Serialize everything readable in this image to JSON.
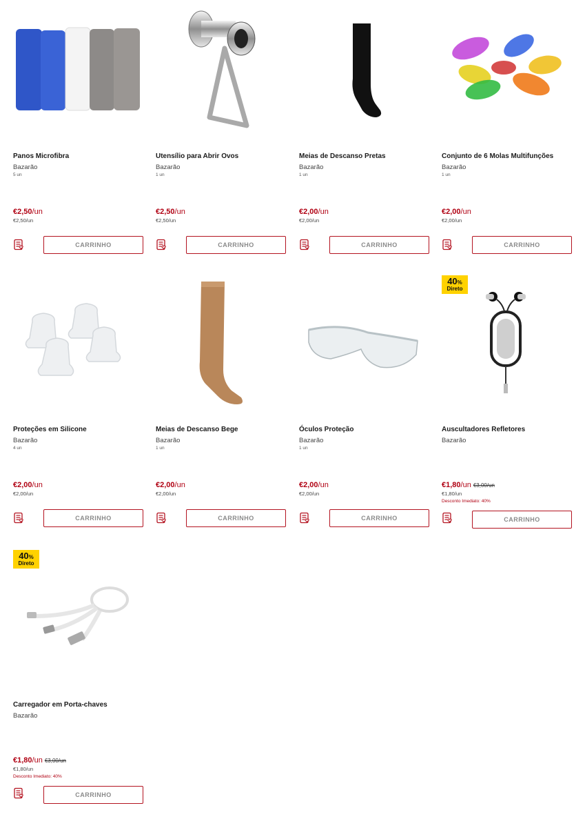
{
  "cart_label": "CARRINHO",
  "badge": {
    "pct": "40",
    "pct_sign": "%",
    "label": "Direto"
  },
  "products": [
    {
      "name": "Panos Microfibra",
      "brand": "Bazarão",
      "qty": "5 un",
      "price": "€2,50",
      "unit": "/un",
      "ppu": "€2,50/un",
      "old": "",
      "discount": "",
      "image_icon": "microfiber-towels"
    },
    {
      "name": "Utensílio para Abrir Ovos",
      "brand": "Bazarão",
      "qty": "1 un",
      "price": "€2,50",
      "unit": "/un",
      "ppu": "€2,50/un",
      "old": "",
      "discount": "",
      "image_icon": "egg-opener"
    },
    {
      "name": "Meias de Descanso Pretas",
      "brand": "Bazarão",
      "qty": "1 un",
      "price": "€2,00",
      "unit": "/un",
      "ppu": "€2,00/un",
      "old": "",
      "discount": "",
      "image_icon": "black-sock"
    },
    {
      "name": "Conjunto de 6 Molas Multifunções",
      "brand": "Bazarão",
      "qty": "1 un",
      "price": "€2,00",
      "unit": "/un",
      "ppu": "€2,00/un",
      "old": "",
      "discount": "",
      "image_icon": "colored-clips"
    },
    {
      "name": "Proteções em Silicone",
      "brand": "Bazarão",
      "qty": "4 un",
      "price": "€2,00",
      "unit": "/un",
      "ppu": "€2,00/un",
      "old": "",
      "discount": "",
      "image_icon": "silicone-caps"
    },
    {
      "name": "Meias de Descanso Bege",
      "brand": "Bazarão",
      "qty": "1 un",
      "price": "€2,00",
      "unit": "/un",
      "ppu": "€2,00/un",
      "old": "",
      "discount": "",
      "image_icon": "beige-sock"
    },
    {
      "name": "Óculos Proteção",
      "brand": "Bazarão",
      "qty": "1 un",
      "price": "€2,00",
      "unit": "/un",
      "ppu": "€2,00/un",
      "old": "",
      "discount": "",
      "image_icon": "safety-glasses"
    },
    {
      "name": "Auscultadores Refletores",
      "brand": "Bazarão",
      "qty": "",
      "price": "€1,80",
      "unit": "/un",
      "ppu": "€1,80/un",
      "old": "€3,00/un",
      "discount": "Desconto Imediato: 40%",
      "image_icon": "earphones"
    },
    {
      "name": "Carregador em Porta-chaves",
      "brand": "Bazarão",
      "qty": "",
      "price": "€1,80",
      "unit": "/un",
      "ppu": "€1,80/un",
      "old": "€3,00/un",
      "discount": "Desconto Imediato: 40%",
      "image_icon": "keychain-charger"
    }
  ],
  "colors": {
    "price_red": "#b00012",
    "button_border": "#b3121f",
    "badge_yellow": "#ffd200"
  }
}
